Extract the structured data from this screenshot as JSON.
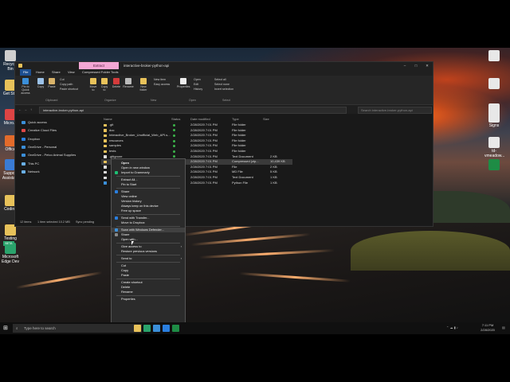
{
  "desktop": {
    "icons_left": [
      {
        "label": "Recycle Bin",
        "color": "#cfcfcf"
      },
      {
        "label": "Get St...",
        "color": "#e8c25a"
      },
      {
        "label": "Micro...",
        "color": "#d44"
      },
      {
        "label": "Office",
        "color": "#e36b2b"
      },
      {
        "label": "Support Assista...",
        "color": "#3a7bd5"
      },
      {
        "label": "Coding",
        "color": "#e8c25a"
      },
      {
        "label": "Testing",
        "color": "#e8c25a"
      },
      {
        "label": "Microsoft Edge Dev",
        "color": "#2aa36b"
      }
    ],
    "icons_right": [
      {
        "label": "",
        "color": "#e8e8e8"
      },
      {
        "label": "",
        "color": "#e8e8e8"
      },
      {
        "label": "",
        "color": "#e8e8e8"
      },
      {
        "label": "Signs",
        "color": "#e8e8e8"
      },
      {
        "label": "td-vmeadow...",
        "color": "#e8e8e8"
      },
      {
        "label": "",
        "color": "#1e8c45"
      }
    ],
    "edge_badge": "BETA"
  },
  "window": {
    "manage_tab": "Extract",
    "title": "interactive-broker-python-api",
    "ribbon_tabs": [
      "File",
      "Home",
      "Share",
      "View",
      "Compressed Folder Tools"
    ],
    "ribbon": {
      "pin": "Pin to Quick access",
      "copy": "Copy",
      "paste": "Paste",
      "cut": "Cut",
      "copy_path": "Copy path",
      "paste_shortcut": "Paste shortcut",
      "move_to": "Move to",
      "copy_to": "Copy to",
      "delete": "Delete",
      "rename": "Rename",
      "new_folder": "New folder",
      "new_item": "New item",
      "easy_access": "Easy access",
      "properties": "Properties",
      "open": "Open",
      "edit": "Edit",
      "history": "History",
      "select_all": "Select all",
      "select_none": "Select none",
      "invert_selection": "Invert selection",
      "groups": [
        "Clipboard",
        "Organize",
        "New",
        "Open",
        "Select"
      ]
    },
    "address": {
      "path": "interactive-broker-python-api",
      "search_placeholder": "Search interactive-broker-python-api"
    },
    "nav_items": [
      {
        "label": "Quick access",
        "color": "#3b8fd9"
      },
      {
        "label": "Creative Cloud Files",
        "color": "#e04848"
      },
      {
        "label": "Dropbox",
        "color": "#2a7fe0"
      },
      {
        "label": "OneDrive - Personal",
        "color": "#3b8fd9"
      },
      {
        "label": "OneDrive - Petco Animal Supplies",
        "color": "#3b8fd9"
      },
      {
        "label": "This PC",
        "color": "#6ab0e8"
      },
      {
        "label": "Network",
        "color": "#6ab0e8"
      }
    ],
    "columns": [
      "Name",
      "Status",
      "Date modified",
      "Type",
      "Size"
    ],
    "files": [
      {
        "name": ".git",
        "date": "2/28/2020 7:01 PM",
        "type": "File folder",
        "size": "",
        "kind": "folder"
      },
      {
        "name": "doc",
        "date": "2/28/2020 7:01 PM",
        "type": "File folder",
        "size": "",
        "kind": "folder"
      },
      {
        "name": "Interactive_Broker_Unofficial_Web_API.s...",
        "date": "2/28/2020 7:01 PM",
        "type": "File folder",
        "size": "",
        "kind": "folder"
      },
      {
        "name": "resources",
        "date": "2/28/2020 7:01 PM",
        "type": "File folder",
        "size": "",
        "kind": "folder"
      },
      {
        "name": "samples",
        "date": "2/28/2020 7:01 PM",
        "type": "File folder",
        "size": "",
        "kind": "folder"
      },
      {
        "name": "tests",
        "date": "2/28/2020 7:01 PM",
        "type": "File folder",
        "size": "",
        "kind": "folder"
      },
      {
        "name": ".gitignore",
        "date": "2/28/2020 7:01 PM",
        "type": "Text Document",
        "size": "2 KB",
        "kind": "file"
      },
      {
        "name": "",
        "date": "2/28/2020 7:01 PM",
        "type": "Compressed (zip...",
        "size": "10,439 KB",
        "kind": "zip"
      },
      {
        "name": "",
        "date": "2/28/2020 7:01 PM",
        "type": "File",
        "size": "2 KB",
        "kind": "file"
      },
      {
        "name": "",
        "date": "2/28/2020 7:01 PM",
        "type": "MD File",
        "size": "5 KB",
        "kind": "file"
      },
      {
        "name": "",
        "date": "2/28/2020 7:01 PM",
        "type": "Text Document",
        "size": "1 KB",
        "kind": "file"
      },
      {
        "name": "",
        "date": "2/28/2020 7:01 PM",
        "type": "Python File",
        "size": "1 KB",
        "kind": "py"
      }
    ],
    "status": {
      "items": "12 items",
      "selected": "1 item selected  10.2 MB",
      "sync": "Sync pending"
    }
  },
  "context_menu": [
    {
      "label": "Open",
      "bold": true
    },
    {
      "label": "Open in new window"
    },
    {
      "label": "Import to Grammarly",
      "icon": "#1dbf73"
    },
    {
      "sep": true
    },
    {
      "label": "Extract All..."
    },
    {
      "label": "Pin to Start"
    },
    {
      "sep": true
    },
    {
      "label": "Share",
      "icon": "#2a7fe0"
    },
    {
      "label": "View online"
    },
    {
      "label": "Version history"
    },
    {
      "label": "Always keep on this device"
    },
    {
      "label": "Free up space"
    },
    {
      "sep": true
    },
    {
      "label": "Send with Transfer...",
      "icon": "#2a7fe0"
    },
    {
      "label": "Move to Dropbox"
    },
    {
      "sep": true
    },
    {
      "label": "Scan with Windows Defender...",
      "icon": "#3b8fd9",
      "hl": true
    },
    {
      "label": "Share",
      "icon": "#888"
    },
    {
      "label": "Open with..."
    },
    {
      "sep": true
    },
    {
      "label": "Give access to",
      "arrow": true
    },
    {
      "label": "Restore previous versions"
    },
    {
      "sep": true
    },
    {
      "label": "Send to",
      "arrow": true
    },
    {
      "sep": true
    },
    {
      "label": "Cut"
    },
    {
      "label": "Copy"
    },
    {
      "label": "Paste"
    },
    {
      "sep": true
    },
    {
      "label": "Create shortcut"
    },
    {
      "label": "Delete"
    },
    {
      "label": "Rename"
    },
    {
      "sep": true
    },
    {
      "label": "Properties"
    }
  ],
  "taskbar": {
    "search_placeholder": "Type here to search",
    "time": "7:11 PM",
    "date": "2/28/2020",
    "apps": [
      "#e8c25a",
      "#2aa36b",
      "#3b8fd9",
      "#2a7fe0",
      "#1e8c45"
    ]
  }
}
